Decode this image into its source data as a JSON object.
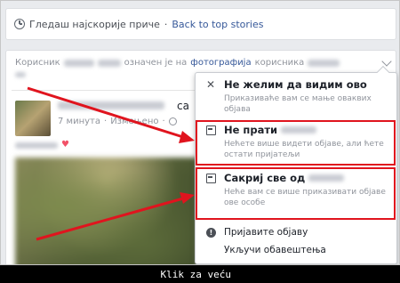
{
  "topbar": {
    "icon": "clock-icon",
    "label": "Гледаш најскорије приче",
    "separator": "·",
    "back_link": "Back to top stories"
  },
  "story": {
    "prefix": "Корисник",
    "tagged_text": "означен је на",
    "photo_link": "фотографија",
    "suffix": "корисника",
    "sa": "са",
    "time": "7 минута",
    "edited": "Измењено",
    "dot": "·"
  },
  "menu": {
    "items": [
      {
        "icon": "close-icon",
        "title": "Не желим да видим ово",
        "desc": "Приказиваће вам се мање оваквих објава"
      },
      {
        "icon": "unfollow-icon",
        "title": "Не прати",
        "desc": "Нећете више видети објаве, али ћете остати пријатељи"
      },
      {
        "icon": "hide-all-icon",
        "title": "Сакриј све од",
        "desc": "Неће вам се више приказивати објаве ове особе"
      },
      {
        "icon": "report-icon",
        "title": "Пријавите објаву"
      },
      {
        "icon": "notifications-icon",
        "title": "Укључи обавештења"
      }
    ]
  },
  "highlight_color": "#e0141e",
  "caption": "Klik za veću"
}
